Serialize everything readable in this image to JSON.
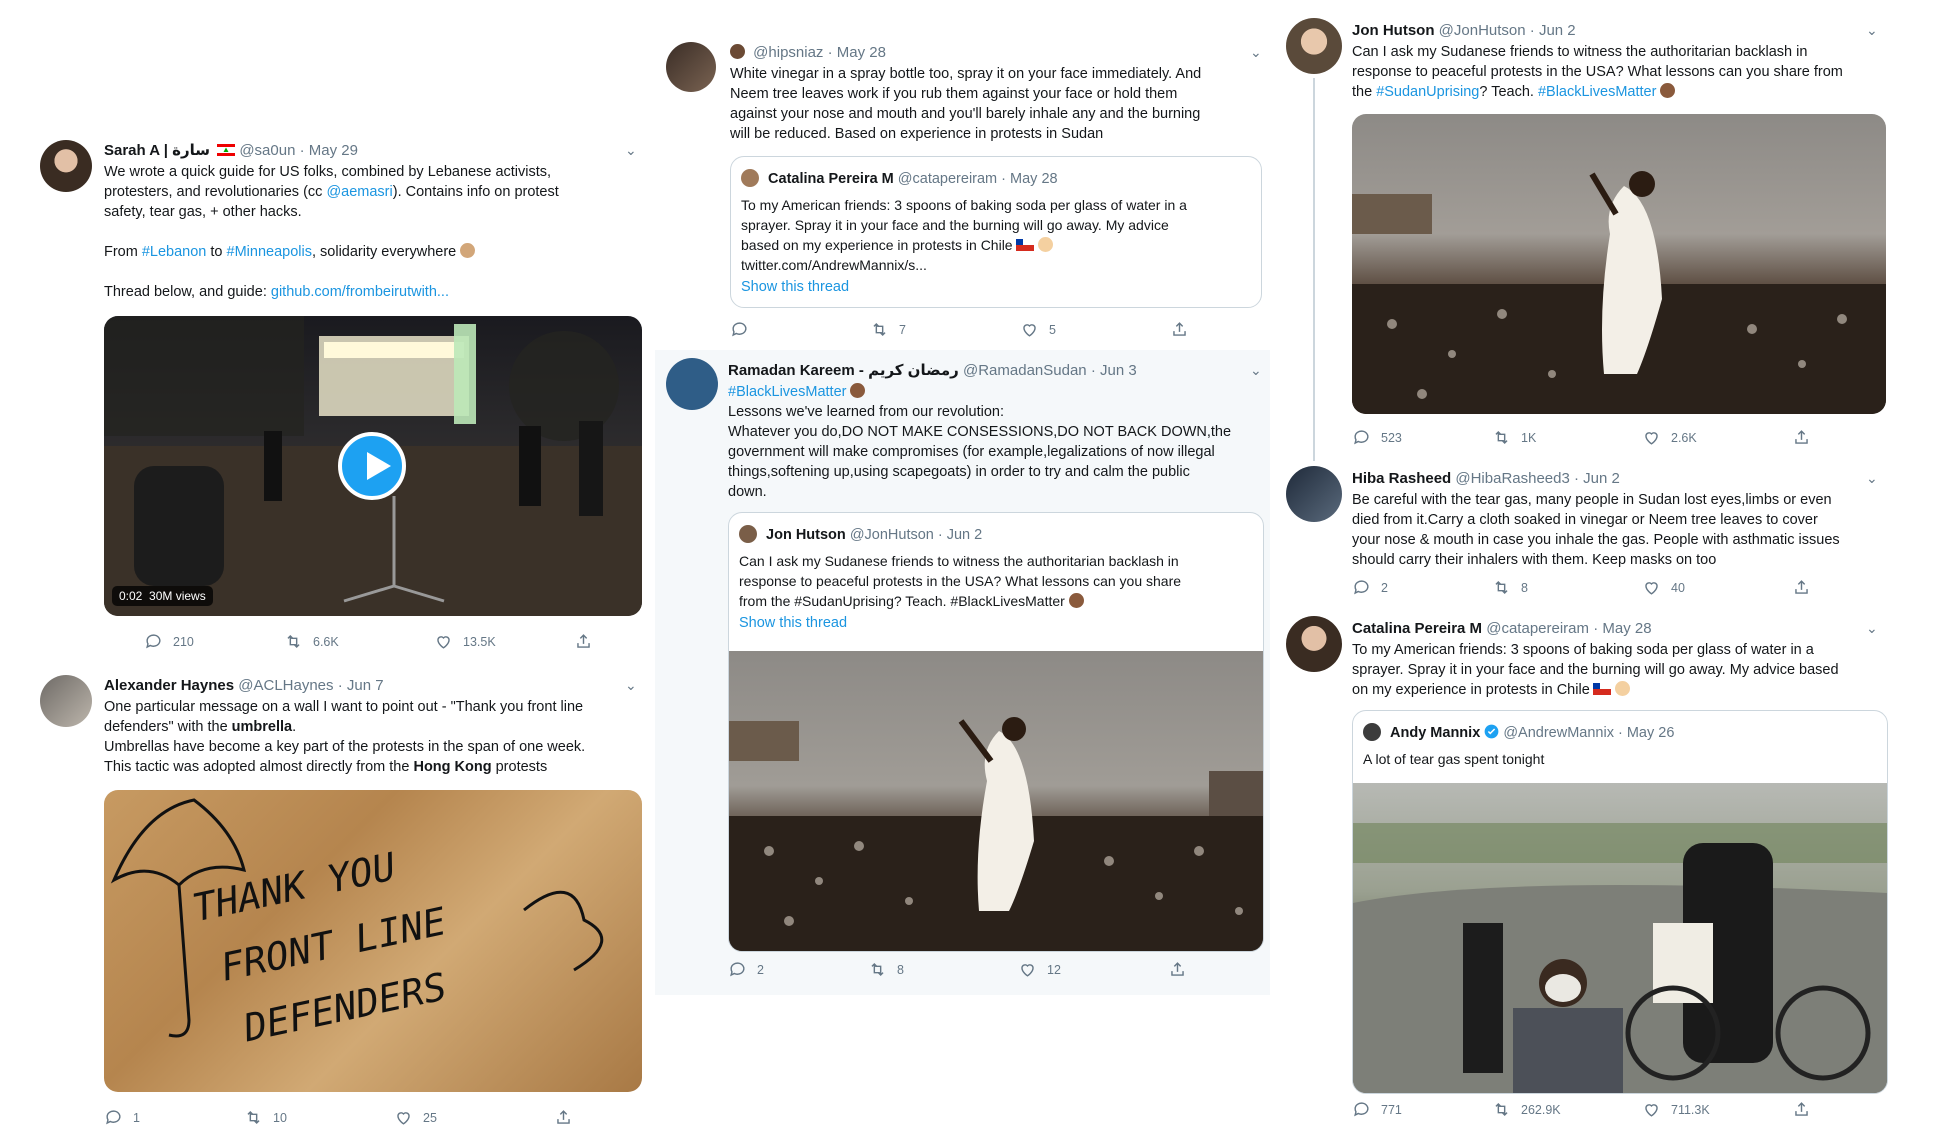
{
  "col1": {
    "t1": {
      "name": "Sarah A | سارة",
      "handle": "@sa0un",
      "date": "· May 29",
      "line1": "We wrote a quick guide for US folks, combined by Lebanese activists,",
      "line2a": "protesters, and revolutionaries (cc ",
      "mention": "@aemasri",
      "line2b": "). Contains info on protest",
      "line3": "safety, tear gas, + other hacks.",
      "from": "From ",
      "tag1": "#Lebanon",
      "to": " to ",
      "tag2": "#Minneapolis",
      "solidarity": ", solidarity everywhere",
      "thread": "Thread below, and guide: ",
      "url": "github.com/frombeirutwith...",
      "video_time": "0:02",
      "video_views": "30M views",
      "replies": "210",
      "retweets": "6.6K",
      "likes": "13.5K"
    },
    "t2": {
      "name": "Alexander Haynes",
      "handle": "@ACLHaynes",
      "date": "· Jun 7",
      "line1": "One particular message on a wall I want to point out - \"Thank you front line",
      "line2a": "defenders\" with the ",
      "bold1": "umbrella",
      "line2b": ".",
      "line3": "Umbrellas have become a key part of the protests in the span of one week.",
      "line4a": "This tactic was adopted almost directly from the ",
      "bold2": "Hong Kong",
      "line4b": " protests",
      "graffiti1": "THANK YOU",
      "graffiti2": "FRONT LINE",
      "graffiti3": "DEFENDERS",
      "replies": "1",
      "retweets": "10",
      "likes": "25"
    }
  },
  "col2": {
    "t1": {
      "handle": "@hipsniaz",
      "date": "· May 28",
      "line1": "White vinegar in a spray bottle too, spray it on your face immediately. And",
      "line2": "Neem tree leaves work if you rub them against your face or hold them",
      "line3": "against your nose and mouth and you'll barely inhale any and the burning",
      "line4": "will be reduced. Based on experience in protests in Sudan",
      "q_name": "Catalina Pereira M",
      "q_handle": "@catapereiram",
      "q_date": "· May 28",
      "q_line1": "To my American friends: 3 spoons of baking soda per glass of water in a",
      "q_line2": "sprayer. Spray it in your face and the burning will go away. My advice",
      "q_line3": "based on my experience in protests in Chile",
      "q_line4": "twitter.com/AndrewMannix/s...",
      "show_thread": "Show this thread",
      "replies": "",
      "retweets": "7",
      "likes": "5"
    },
    "t2": {
      "name": "Ramadan Kareem - رمضان كريم",
      "handle": "@RamadanSudan",
      "date": "· Jun 3",
      "tag": "#BlackLivesMatter",
      "line1": "Lessons we've learned from our revolution:",
      "line2": "Whatever you do,DO NOT MAKE CONSESSIONS,DO NOT BACK DOWN,the",
      "line3": "government will make compromises (for example,legalizations of now illegal",
      "line4": "things,softening up,using scapegoats) in order to try and calm the public",
      "line5": "down.",
      "q_name": "Jon Hutson",
      "q_handle": "@JonHutson",
      "q_date": "· Jun 2",
      "q_line1": "Can I ask my Sudanese friends to witness the authoritarian backlash in",
      "q_line2": "response to peaceful protests in the USA? What lessons can you share",
      "q_line3": "from the #SudanUprising? Teach. #BlackLivesMatter",
      "show_thread": "Show this thread",
      "replies": "2",
      "retweets": "8",
      "likes": "12"
    }
  },
  "col3": {
    "t1": {
      "name": "Jon Hutson",
      "handle": "@JonHutson",
      "date": "· Jun 2",
      "line1": "Can I ask my Sudanese friends to witness the authoritarian backlash in",
      "line2": "response to peaceful protests in the USA? What lessons can you share from",
      "line3a": "the ",
      "tag1": "#SudanUprising",
      "line3b": "? Teach. ",
      "tag2": "#BlackLivesMatter",
      "replies": "523",
      "retweets": "1K",
      "likes": "2.6K"
    },
    "t2": {
      "name": "Hiba Rasheed",
      "handle": "@HibaRasheed3",
      "date": "· Jun 2",
      "line1": "Be careful with the tear gas, many people in Sudan lost eyes,limbs or even",
      "line2": "died from it.Carry a cloth soaked in vinegar or Neem tree leaves to cover",
      "line3": "your nose & mouth in case you inhale the gas. People with asthmatic issues",
      "line4": "should carry their inhalers with them. Keep masks on too",
      "replies": "2",
      "retweets": "8",
      "likes": "40"
    },
    "t3": {
      "name": "Catalina Pereira M",
      "handle": "@catapereiram",
      "date": "· May 28",
      "line1": "To my American friends: 3 spoons of baking soda per glass of water in a",
      "line2": "sprayer. Spray it in your face and the burning will go away. My advice based",
      "line3": "on my experience in protests in Chile",
      "q_name": "Andy Mannix",
      "q_handle": "@AndrewMannix",
      "q_date": "· May 26",
      "q_line1": "A lot of tear gas spent tonight",
      "replies": "771",
      "retweets": "262.9K",
      "likes": "711.3K"
    }
  },
  "colors": {
    "link": "#1b95e0",
    "meta": "#657786",
    "border": "#ccd6dd",
    "verified": "#1da1f2"
  }
}
